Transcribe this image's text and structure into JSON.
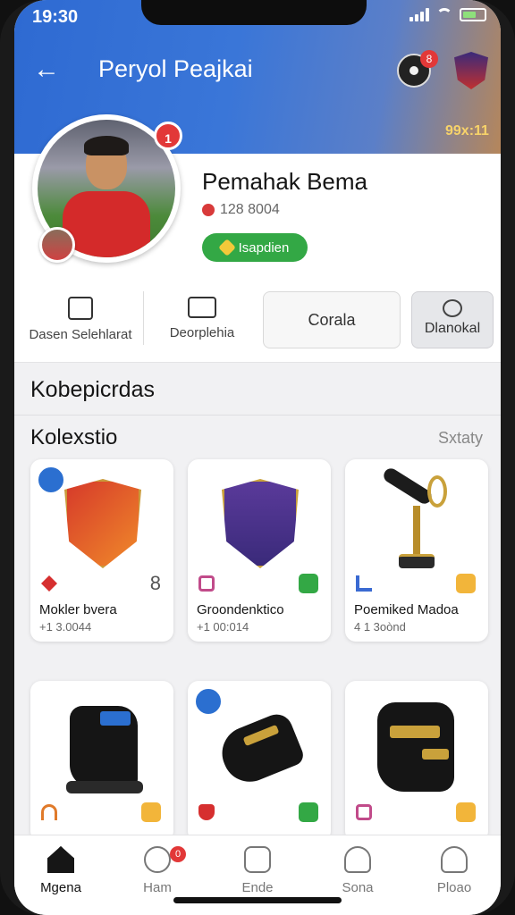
{
  "status_bar": {
    "time": "19:30"
  },
  "header": {
    "title": "Peryol Peajkai",
    "notification_count": "8",
    "code": "99x:11"
  },
  "profile": {
    "avatar_badge": "1",
    "name": "Pemahak Bema",
    "meta": "128 8004",
    "verified_label": "Isapdien"
  },
  "actions": {
    "item1_label": "Dasen Selehlarat",
    "item2_label": "Deorplehia",
    "outline_button": "Corala",
    "filled_button": "Dlanokal"
  },
  "sections": {
    "title": "Kobepicrdas",
    "collection_title": "Kolexstio",
    "sort_label": "Sxtaty"
  },
  "cards": [
    {
      "name": "Mokler bvera",
      "sub": "+1 3.0044",
      "count": "8"
    },
    {
      "name": "Groondenktico",
      "sub": "+1 00:014",
      "count": ""
    },
    {
      "name": "Poemiked Madoa",
      "sub": "4 1 3oònd",
      "count": ""
    },
    {
      "name": "",
      "sub": "",
      "count": ""
    },
    {
      "name": "",
      "sub": "",
      "count": ""
    },
    {
      "name": "",
      "sub": "",
      "count": ""
    }
  ],
  "nav": {
    "items": [
      {
        "label": "Mgena"
      },
      {
        "label": "Ham"
      },
      {
        "label": "Ende"
      },
      {
        "label": "Sona"
      },
      {
        "label": "Ploao"
      }
    ],
    "badge": "0"
  },
  "colors": {
    "accent": "#2e6ad2",
    "verified": "#33a845",
    "badge": "#e23838"
  }
}
